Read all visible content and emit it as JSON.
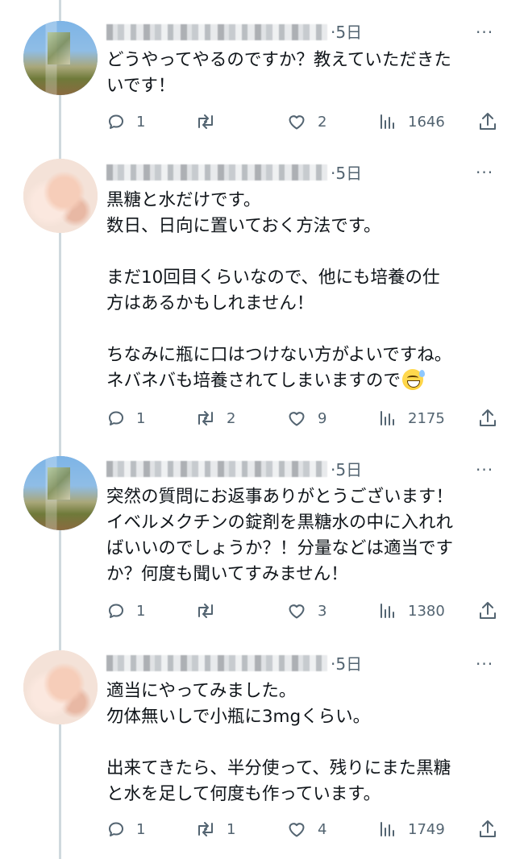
{
  "replies": [
    {
      "time": "·5日",
      "more": "···",
      "text": "どうやってやるのですか？教えていただきた\nいです！",
      "emoji": "",
      "stats": {
        "replies": "1",
        "retweets": "",
        "likes": "2",
        "views": "1646"
      }
    },
    {
      "time": "·5日",
      "more": "···",
      "text": "黒糖と水だけです。\n数日、日向に置いておく方法です。\n\nまだ10回目くらいなので、他にも培養の仕\n方はあるかもしれません！\n\nちなみに瓶に口はつけない方がよいですね。\nネバネバも培養されてしまいますので",
      "emoji": "grinning-face-with-sweat",
      "stats": {
        "replies": "1",
        "retweets": "2",
        "likes": "9",
        "views": "2175"
      }
    },
    {
      "time": "·5日",
      "more": "···",
      "text": "突然の質問にお返事ありがとうございます！\nイベルメクチンの錠剤を黒糖水の中に入れれ\nばいいのでしょうか？！分量などは適当です\nか？何度も聞いてすみません！",
      "emoji": "",
      "stats": {
        "replies": "1",
        "retweets": "",
        "likes": "3",
        "views": "1380"
      }
    },
    {
      "time": "·5日",
      "more": "···",
      "text": "適当にやってみました。\n勿体無いしで小瓶に3mgくらい。\n\n出来てきたら、半分使って、残りにまた黒糖\nと水を足して何度も作っています。",
      "emoji": "",
      "stats": {
        "replies": "1",
        "retweets": "1",
        "likes": "4",
        "views": "1749"
      }
    }
  ],
  "colors": {
    "text": "#0f1419",
    "muted": "#536471",
    "thread_line": "#cfd9de"
  }
}
